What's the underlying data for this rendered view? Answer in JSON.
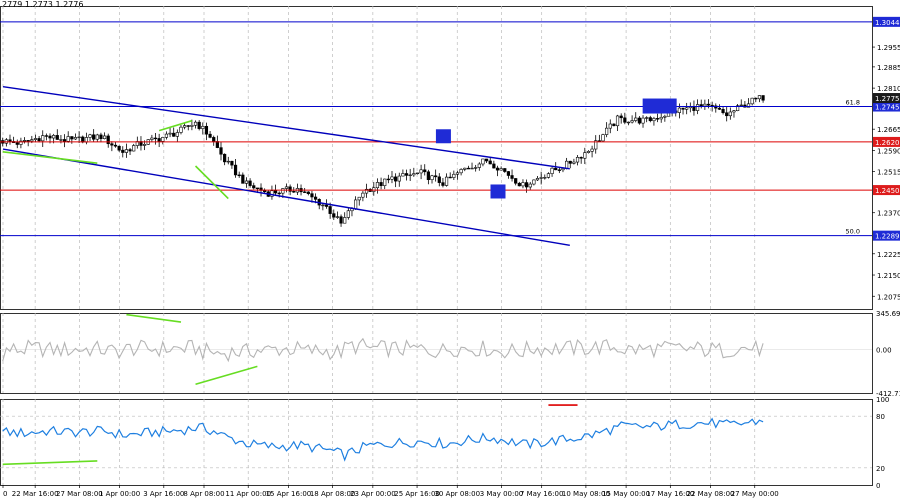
{
  "header": {
    "ohlc": "2779 1.2773 1.2776"
  },
  "colors": {
    "candle": "#000000",
    "bull_body": "#ffffff",
    "channel": "#0000bb",
    "support_blue": "#0000cc",
    "support_red": "#dd0000",
    "divergence": "#66dd22",
    "marker": "#1f2bd6",
    "cci_line": "#b4b4b4",
    "rsi_line": "#1e7fe0",
    "price_box_blue": "#1f2bd6",
    "price_box_red": "#dd1c1c",
    "price_box_dark": "#1a1a1a"
  },
  "chart_data": [
    {
      "type": "candlestick",
      "instrument_digits": 4,
      "ylim": [
        1.203,
        1.31
      ],
      "x_count": 190,
      "x_tick_labels": [
        {
          "i": 0,
          "label": "0"
        },
        {
          "i": 8,
          "label": "22 Mar 16:00"
        },
        {
          "i": 19,
          "label": "27 Mar 08:00"
        },
        {
          "i": 29,
          "label": "1 Apr 00:00"
        },
        {
          "i": 40,
          "label": "3 Apr 16:00"
        },
        {
          "i": 50,
          "label": "8 Apr 08:00"
        },
        {
          "i": 61,
          "label": "11 Apr 00:00"
        },
        {
          "i": 71,
          "label": "15 Apr 16:00"
        },
        {
          "i": 82,
          "label": "18 Apr 08:00"
        },
        {
          "i": 92,
          "label": "23 Apr 00:00"
        },
        {
          "i": 103,
          "label": "25 Apr 16:00"
        },
        {
          "i": 113,
          "label": "30 Apr 08:00"
        },
        {
          "i": 124,
          "label": "3 May 00:00"
        },
        {
          "i": 134,
          "label": "7 May 16:00"
        },
        {
          "i": 145,
          "label": "10 May 08:00"
        },
        {
          "i": 155,
          "label": "15 May 00:00"
        },
        {
          "i": 166,
          "label": "17 May 16:00"
        },
        {
          "i": 176,
          "label": "22 May 08:00"
        },
        {
          "i": 187,
          "label": "27 May 00:00"
        }
      ],
      "y_tick_labels": [
        "1.2955",
        "1.2885",
        "1.2810",
        "1.2665",
        "1.2590",
        "1.2515",
        "1.2370",
        "1.2225",
        "1.2150",
        "1.2075"
      ],
      "price_points": [
        [
          0,
          1.2625
        ],
        [
          6,
          1.2615
        ],
        [
          12,
          1.264
        ],
        [
          20,
          1.2625
        ],
        [
          28,
          1.264
        ],
        [
          34,
          1.2585
        ],
        [
          38,
          1.261
        ],
        [
          46,
          1.264
        ],
        [
          50,
          1.266
        ],
        [
          54,
          1.269
        ],
        [
          58,
          1.264
        ],
        [
          62,
          1.2555
        ],
        [
          68,
          1.247
        ],
        [
          74,
          1.244
        ],
        [
          82,
          1.2455
        ],
        [
          90,
          1.239
        ],
        [
          94,
          1.233
        ],
        [
          100,
          1.2445
        ],
        [
          108,
          1.249
        ],
        [
          116,
          1.251
        ],
        [
          122,
          1.2475
        ],
        [
          128,
          1.2525
        ],
        [
          134,
          1.2555
        ],
        [
          138,
          1.2525
        ],
        [
          144,
          1.2465
        ],
        [
          150,
          1.2505
        ],
        [
          156,
          1.254
        ],
        [
          162,
          1.259
        ],
        [
          170,
          1.27
        ],
        [
          178,
          1.2695
        ],
        [
          186,
          1.273
        ],
        [
          192,
          1.2745
        ],
        [
          196,
          1.274
        ],
        [
          200,
          1.2715
        ],
        [
          206,
          1.276
        ],
        [
          210,
          1.2778
        ]
      ],
      "levels": [
        {
          "price": 1.3044,
          "label": "1.3044",
          "color": "blue",
          "text": ""
        },
        {
          "price": 1.2745,
          "label": "1.2745",
          "color": "blue",
          "text": "61.8"
        },
        {
          "price": 1.262,
          "label": "1.2620",
          "color": "red",
          "text": ""
        },
        {
          "price": 1.245,
          "label": "1.2450",
          "color": "red",
          "text": ""
        },
        {
          "price": 1.2289,
          "label": "1.2289",
          "color": "blue",
          "text": "50.0"
        }
      ],
      "current_price": {
        "price": 1.2775,
        "label": "1.2775"
      },
      "channel": {
        "upper": [
          [
            0,
            1.2815
          ],
          [
            141,
            1.2525
          ]
        ],
        "lower": [
          [
            0,
            1.2595
          ],
          [
            141,
            1.2255
          ]
        ]
      },
      "divergences": [
        {
          "from": [
            0,
            1.2585
          ],
          "to": [
            26,
            1.2545
          ]
        },
        {
          "from": [
            43,
            1.266
          ],
          "to": [
            52,
            1.2695
          ]
        },
        {
          "from": [
            53,
            1.2535
          ],
          "to": [
            62,
            1.242
          ]
        }
      ],
      "markers": [
        {
          "i": 121,
          "price": 1.264,
          "kind": "up"
        },
        {
          "i": 136,
          "price": 1.2445,
          "kind": "down"
        },
        {
          "i": 177,
          "price": 1.2745,
          "kind": "up"
        }
      ]
    },
    {
      "type": "line",
      "indicator": "CCI",
      "ylim": [
        -412.715,
        345.6926
      ],
      "y_tick_labels": [
        "345.6926",
        "0.00",
        "-412.715"
      ],
      "divergences": [
        {
          "from": [
            34,
            330
          ],
          "to": [
            49,
            260
          ]
        },
        {
          "from": [
            53,
            -330
          ],
          "to": [
            70,
            -160
          ]
        }
      ]
    },
    {
      "type": "line",
      "indicator": "RSI",
      "ylim": [
        0,
        100
      ],
      "levels": [
        80,
        20
      ],
      "y_tick_labels": [
        "100",
        "80",
        "20",
        "0"
      ],
      "divergences": [
        {
          "from": [
            0,
            24
          ],
          "to": [
            26,
            28
          ]
        }
      ],
      "marker_red_line": {
        "from": 150,
        "to": 158,
        "value": 93
      }
    }
  ]
}
